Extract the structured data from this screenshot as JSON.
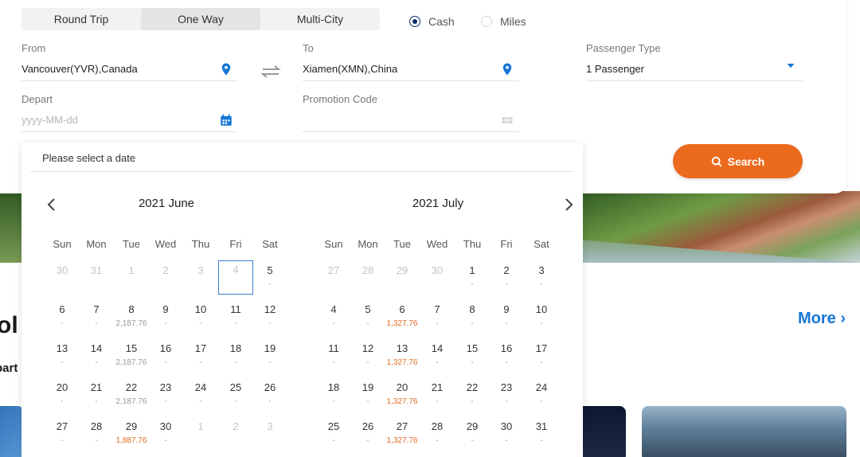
{
  "trip_tabs": [
    "Round Trip",
    "One Way",
    "Multi-City"
  ],
  "active_trip_tab": 1,
  "payment": {
    "cash_label": "Cash",
    "miles_label": "Miles",
    "selected": "Cash"
  },
  "from": {
    "label": "From",
    "value": "Vancouver(YVR),Canada"
  },
  "to": {
    "label": "To",
    "value": "Xiamen(XMN),China"
  },
  "passenger": {
    "label": "Passenger Type",
    "value": "1 Passenger"
  },
  "depart": {
    "label": "Depart",
    "placeholder": "yyyy-MM-dd"
  },
  "promo": {
    "label": "Promotion Code",
    "value": ""
  },
  "search": {
    "label": "Search"
  },
  "picker": {
    "header": "Please select a date",
    "weekdays": [
      "Sun",
      "Mon",
      "Tue",
      "Wed",
      "Thu",
      "Fri",
      "Sat"
    ],
    "months": [
      {
        "title": "2021 June",
        "weeks": [
          [
            {
              "d": "30",
              "p": "",
              "dis": true
            },
            {
              "d": "31",
              "p": "",
              "dis": true
            },
            {
              "d": "1",
              "p": "",
              "dis": true
            },
            {
              "d": "2",
              "p": "",
              "dis": true
            },
            {
              "d": "3",
              "p": "",
              "dis": true
            },
            {
              "d": "4",
              "p": "",
              "dis": true,
              "sel": true
            },
            {
              "d": "5",
              "p": "-"
            }
          ],
          [
            {
              "d": "6",
              "p": "-"
            },
            {
              "d": "7",
              "p": "-"
            },
            {
              "d": "8",
              "p": "2,187.76"
            },
            {
              "d": "9",
              "p": "-"
            },
            {
              "d": "10",
              "p": "-"
            },
            {
              "d": "11",
              "p": "-"
            },
            {
              "d": "12",
              "p": "-"
            }
          ],
          [
            {
              "d": "13",
              "p": "-"
            },
            {
              "d": "14",
              "p": "-"
            },
            {
              "d": "15",
              "p": "2,187.76"
            },
            {
              "d": "16",
              "p": "-"
            },
            {
              "d": "17",
              "p": "-"
            },
            {
              "d": "18",
              "p": "-"
            },
            {
              "d": "19",
              "p": "-"
            }
          ],
          [
            {
              "d": "20",
              "p": "-"
            },
            {
              "d": "21",
              "p": "-"
            },
            {
              "d": "22",
              "p": "2,187.76"
            },
            {
              "d": "23",
              "p": "-"
            },
            {
              "d": "24",
              "p": "-"
            },
            {
              "d": "25",
              "p": "-"
            },
            {
              "d": "26",
              "p": "-"
            }
          ],
          [
            {
              "d": "27",
              "p": "-"
            },
            {
              "d": "28",
              "p": "-"
            },
            {
              "d": "29",
              "p": "1,887.76",
              "low": true
            },
            {
              "d": "30",
              "p": "-"
            },
            {
              "d": "1",
              "p": "",
              "dis": true
            },
            {
              "d": "2",
              "p": "",
              "dis": true
            },
            {
              "d": "3",
              "p": "",
              "dis": true
            }
          ]
        ]
      },
      {
        "title": "2021 July",
        "weeks": [
          [
            {
              "d": "27",
              "p": "",
              "dis": true
            },
            {
              "d": "28",
              "p": "",
              "dis": true
            },
            {
              "d": "29",
              "p": "",
              "dis": true
            },
            {
              "d": "30",
              "p": "",
              "dis": true
            },
            {
              "d": "1",
              "p": "-"
            },
            {
              "d": "2",
              "p": "-"
            },
            {
              "d": "3",
              "p": "-"
            }
          ],
          [
            {
              "d": "4",
              "p": "-"
            },
            {
              "d": "5",
              "p": "-"
            },
            {
              "d": "6",
              "p": "1,327.76",
              "low": true
            },
            {
              "d": "7",
              "p": "-"
            },
            {
              "d": "8",
              "p": "-"
            },
            {
              "d": "9",
              "p": "-"
            },
            {
              "d": "10",
              "p": "-"
            }
          ],
          [
            {
              "d": "11",
              "p": "-"
            },
            {
              "d": "12",
              "p": "-"
            },
            {
              "d": "13",
              "p": "1,327.76",
              "low": true
            },
            {
              "d": "14",
              "p": "-"
            },
            {
              "d": "15",
              "p": "-"
            },
            {
              "d": "16",
              "p": "-"
            },
            {
              "d": "17",
              "p": "-"
            }
          ],
          [
            {
              "d": "18",
              "p": "-"
            },
            {
              "d": "19",
              "p": "-"
            },
            {
              "d": "20",
              "p": "1,327.76",
              "low": true
            },
            {
              "d": "21",
              "p": "-"
            },
            {
              "d": "22",
              "p": "-"
            },
            {
              "d": "23",
              "p": "-"
            },
            {
              "d": "24",
              "p": "-"
            }
          ],
          [
            {
              "d": "25",
              "p": "-"
            },
            {
              "d": "26",
              "p": "-"
            },
            {
              "d": "27",
              "p": "1,327.76",
              "low": true
            },
            {
              "d": "28",
              "p": "-"
            },
            {
              "d": "29",
              "p": "-"
            },
            {
              "d": "30",
              "p": "-"
            },
            {
              "d": "31",
              "p": "-"
            }
          ]
        ]
      }
    ]
  },
  "background": {
    "heading": "ol",
    "subtext": "part",
    "more_label": "More"
  },
  "colors": {
    "accent_blue": "#1677d6",
    "search_orange": "#ec6a1e",
    "low_price": "#e06a23",
    "radio_selected": "#0b2f6b"
  },
  "icons": [
    "location-pin-icon",
    "swap-arrows-icon",
    "calendar-icon",
    "ticket-icon",
    "caret-down-icon",
    "search-icon",
    "chevron-left-icon",
    "chevron-right-icon"
  ]
}
